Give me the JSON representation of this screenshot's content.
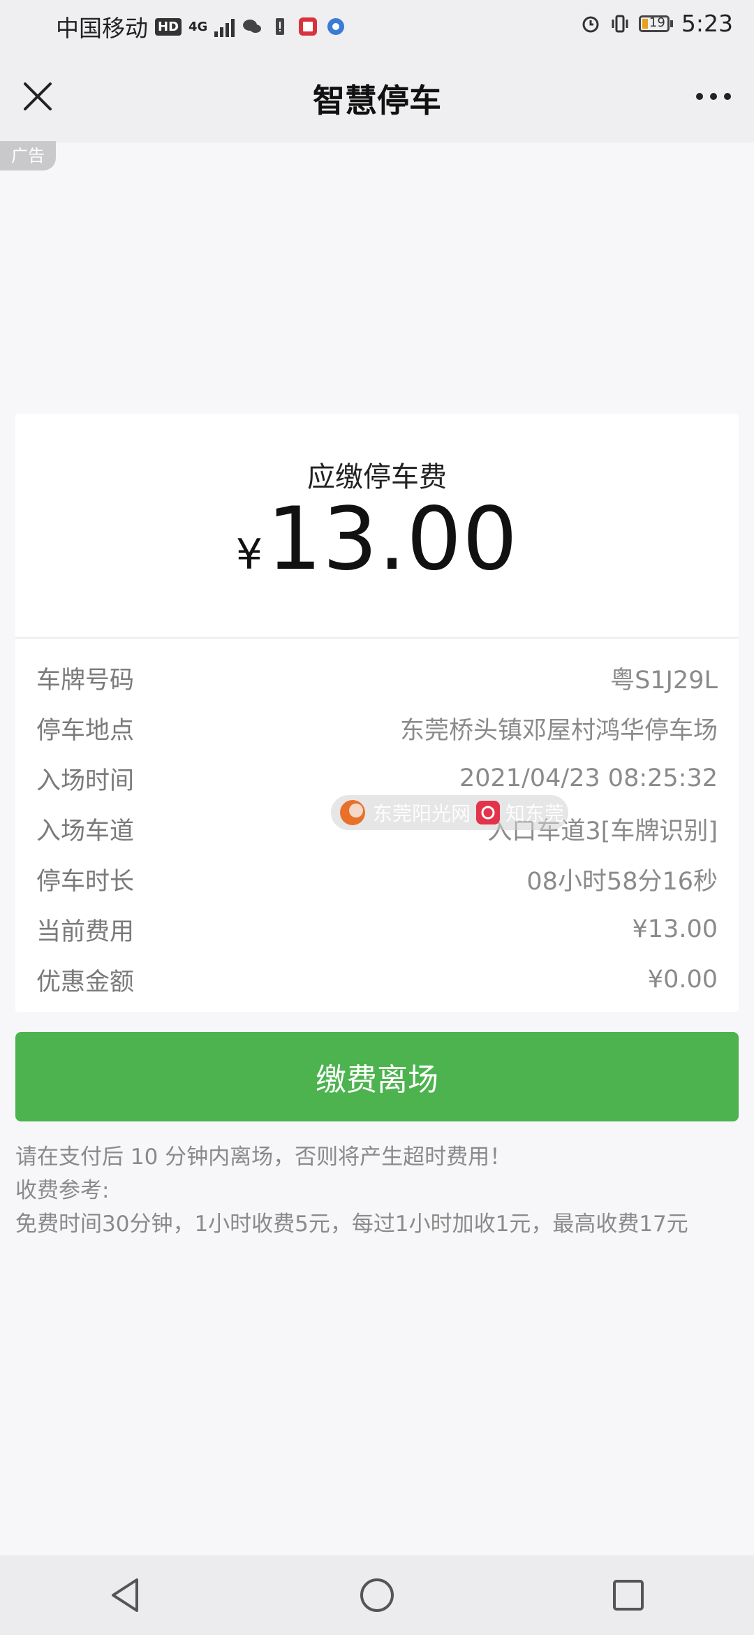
{
  "status_bar": {
    "carrier": "中国移动",
    "hd": "HD",
    "network": "4G",
    "battery": "19",
    "time": "5:23"
  },
  "header": {
    "title": "智慧停车",
    "ad_label": "广告"
  },
  "fee": {
    "label": "应缴停车费",
    "currency_symbol": "¥",
    "amount": "13.00"
  },
  "details": [
    {
      "key": "车牌号码",
      "value": "粤S1J29L"
    },
    {
      "key": "停车地点",
      "value": "东莞桥头镇邓屋村鸿华停车场"
    },
    {
      "key": "入场时间",
      "value": "2021/04/23 08:25:32"
    },
    {
      "key": "入场车道",
      "value": "入口车道3[车牌识别]"
    },
    {
      "key": "停车时长",
      "value": "08小时58分16秒"
    },
    {
      "key": "当前费用",
      "value": "¥13.00"
    },
    {
      "key": "优惠金额",
      "value": "¥0.00"
    }
  ],
  "watermark": {
    "text1": "东莞阳光网",
    "text2": "知东莞"
  },
  "pay_button": "缴费离场",
  "notes": {
    "line1": "请在支付后 10 分钟内离场，否则将产生超时费用！",
    "line2": "收费参考:",
    "line3": "免费时间30分钟，1小时收费5元，每过1小时加收1元，最高收费17元"
  },
  "colors": {
    "primary_green": "#4cb34e",
    "page_bg": "#f7f7f9"
  }
}
